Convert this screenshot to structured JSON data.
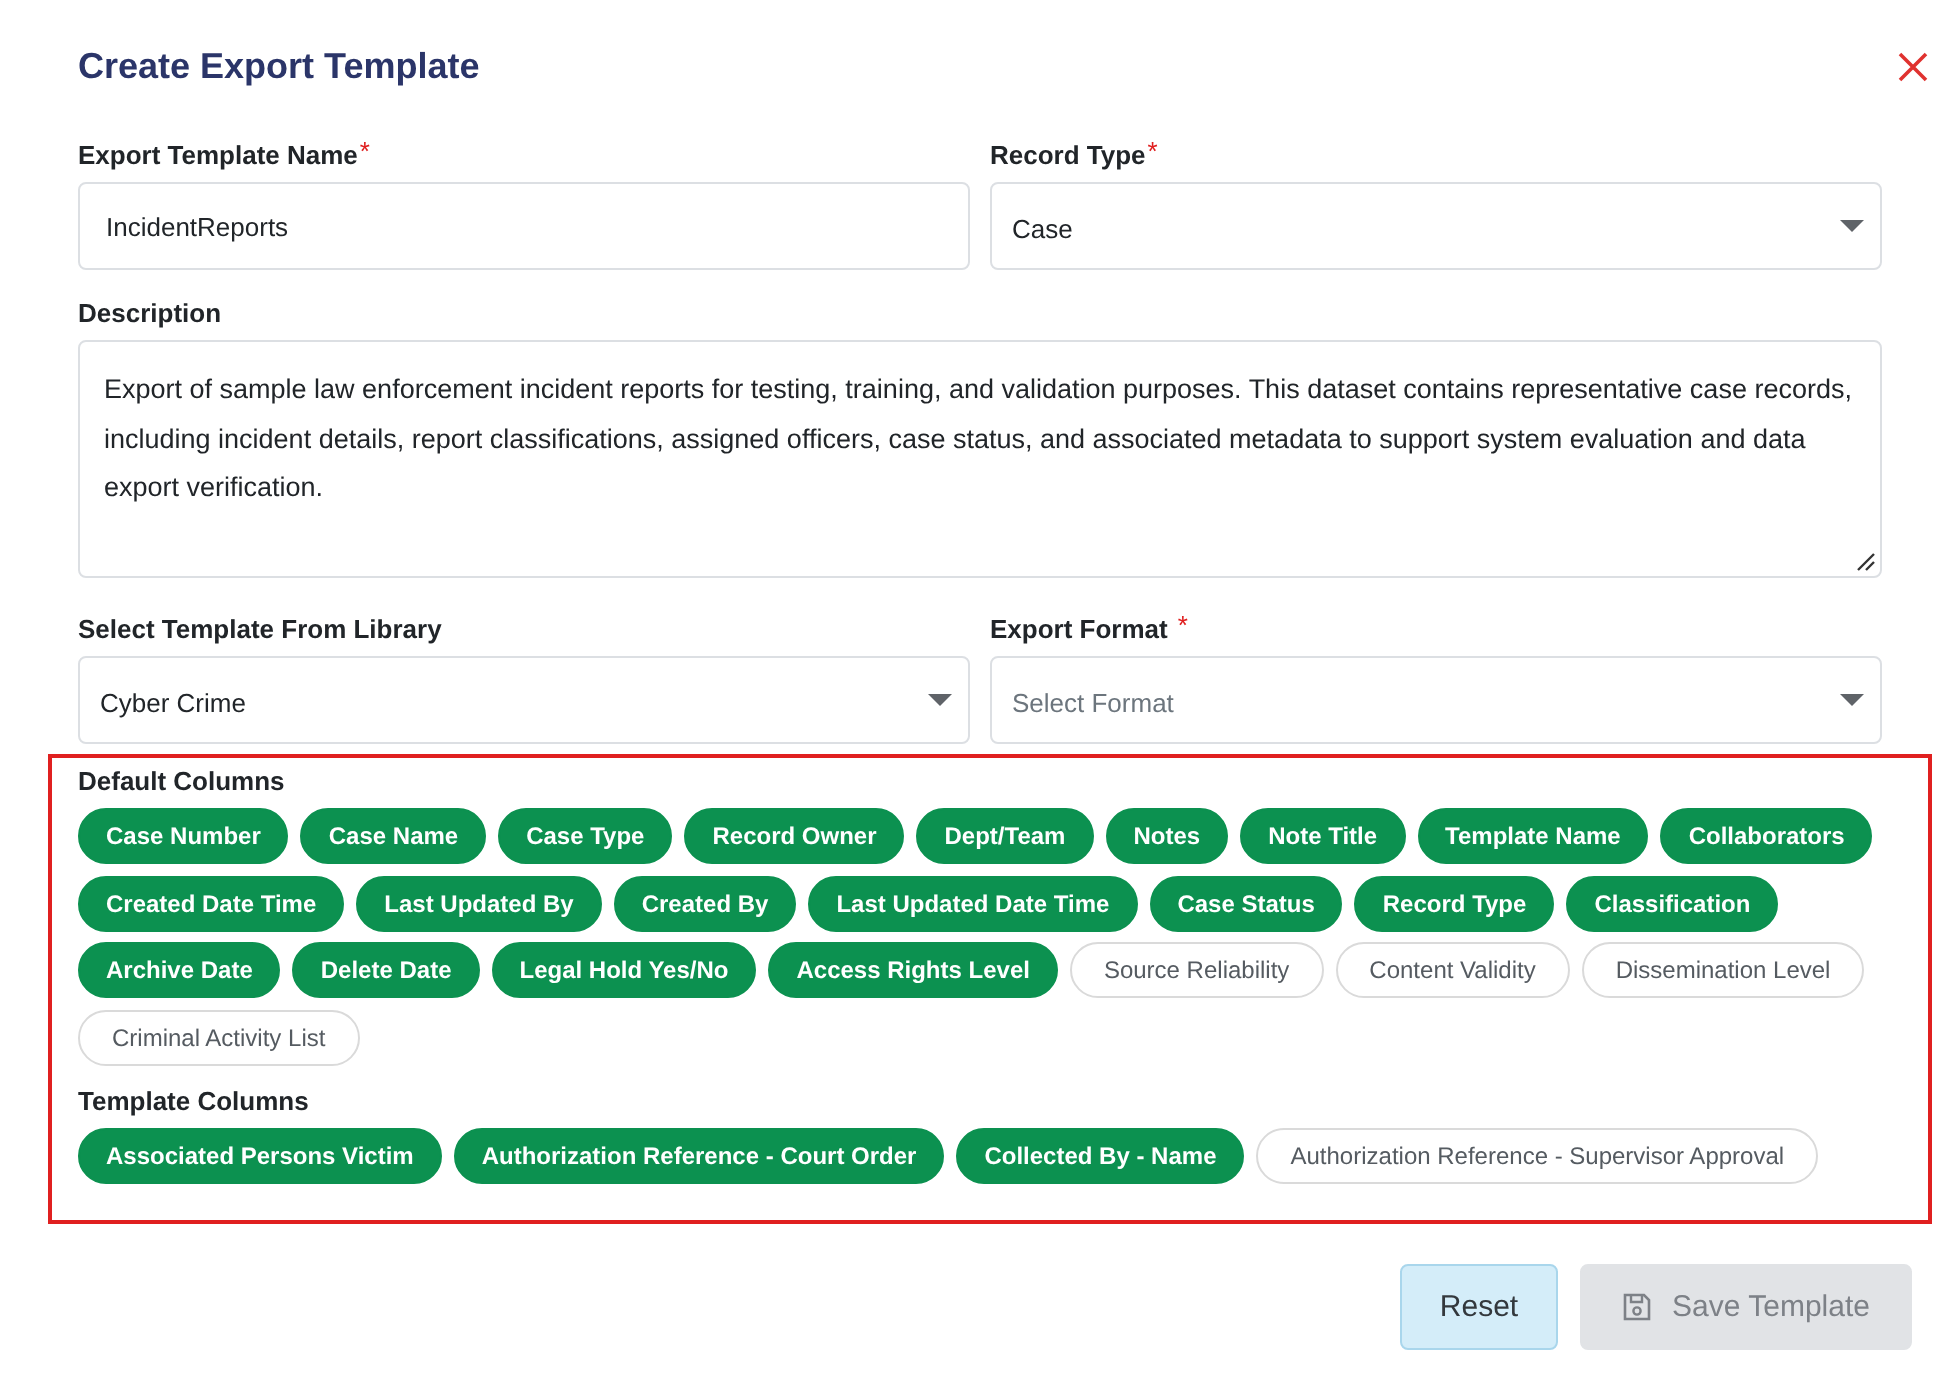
{
  "dialog": {
    "title": "Create Export Template"
  },
  "fields": [
    {
      "kind": "text",
      "label": "Export Template Name",
      "required_mark": "*",
      "value": "IncidentReports"
    },
    {
      "kind": "select",
      "label": "Record Type",
      "required_mark": "*",
      "value": "Case"
    },
    {
      "kind": "textarea",
      "label": "Description",
      "value": "Export of sample law enforcement incident reports for testing, training, and validation purposes. This dataset contains representative case records, including incident details, report classifications, assigned officers, case status, and associated metadata to support system evaluation and data export verification."
    },
    {
      "kind": "select",
      "label": "Select Template From Library",
      "value": "Cyber Crime"
    },
    {
      "kind": "select",
      "label": "Export Format",
      "required_mark": "*",
      "placeholder": "Select Format"
    }
  ],
  "columns_panel": {
    "highlighted": true,
    "groups": [
      {
        "title": "Default Columns",
        "columns": [
          {
            "label": "Case Number",
            "selected": true
          },
          {
            "label": "Case Name",
            "selected": true
          },
          {
            "label": "Case Type",
            "selected": true
          },
          {
            "label": "Record Owner",
            "selected": true
          },
          {
            "label": "Dept/Team",
            "selected": true
          },
          {
            "label": "Notes",
            "selected": true
          },
          {
            "label": "Note Title",
            "selected": true
          },
          {
            "label": "Template Name",
            "selected": true
          },
          {
            "label": "Collaborators",
            "selected": true
          },
          {
            "label": "Created Date Time",
            "selected": true
          },
          {
            "label": "Last Updated By",
            "selected": true
          },
          {
            "label": "Created By",
            "selected": true
          },
          {
            "label": "Last Updated Date Time",
            "selected": true
          },
          {
            "label": "Case Status",
            "selected": true
          },
          {
            "label": "Record Type",
            "selected": true
          },
          {
            "label": "Classification",
            "selected": true
          },
          {
            "label": "Archive Date",
            "selected": true
          },
          {
            "label": "Delete Date",
            "selected": true
          },
          {
            "label": "Legal Hold Yes/No",
            "selected": true
          },
          {
            "label": "Access Rights Level",
            "selected": true
          },
          {
            "label": "Source Reliability",
            "selected": false
          },
          {
            "label": "Content Validity",
            "selected": false
          },
          {
            "label": "Dissemination Level",
            "selected": false
          },
          {
            "label": "Criminal Activity List",
            "selected": false
          }
        ]
      },
      {
        "title": "Template Columns",
        "columns": [
          {
            "label": "Associated Persons Victim",
            "selected": true
          },
          {
            "label": "Authorization Reference - Court Order",
            "selected": true
          },
          {
            "label": "Collected By - Name",
            "selected": true
          },
          {
            "label": "Authorization Reference - Supervisor Approval",
            "selected": false
          }
        ]
      }
    ]
  },
  "buttons": [
    {
      "kind": "reset",
      "label": "Reset",
      "disabled": false
    },
    {
      "kind": "save",
      "label": "Save Template",
      "disabled": true
    }
  ]
}
